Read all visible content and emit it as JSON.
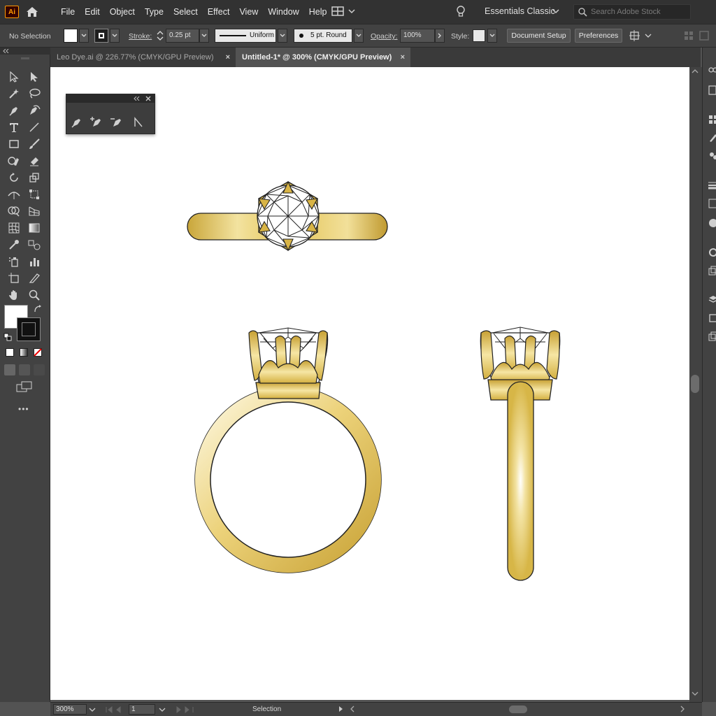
{
  "app": {
    "logo": "Ai"
  },
  "menu": [
    "File",
    "Edit",
    "Object",
    "Type",
    "Select",
    "Effect",
    "View",
    "Window",
    "Help"
  ],
  "workspace": "Essentials Classic",
  "search_placeholder": "Search Adobe Stock",
  "control": {
    "selection": "No Selection",
    "stroke_label": "Stroke:",
    "stroke_value": "0.25 pt",
    "profile": "Uniform",
    "brush": "5 pt. Round",
    "opacity_label": "Opacity:",
    "opacity_value": "100%",
    "style_label": "Style:",
    "document_setup": "Document Setup",
    "preferences": "Preferences"
  },
  "tabs": [
    {
      "label": "Leo Dye.ai @ 226.77% (CMYK/GPU Preview)",
      "active": false
    },
    {
      "label": "Untitled-1* @ 300% (CMYK/GPU Preview)",
      "active": true
    }
  ],
  "tab_close": "×",
  "status": {
    "zoom": "300%",
    "artboard": "1",
    "tool": "Selection"
  },
  "colors": {
    "accent": "#ff9a00",
    "gold_light": "#f7e9a8",
    "gold_mid": "#e7c65b",
    "gold_dark": "#b08a24"
  },
  "toolbar_more": "•••"
}
